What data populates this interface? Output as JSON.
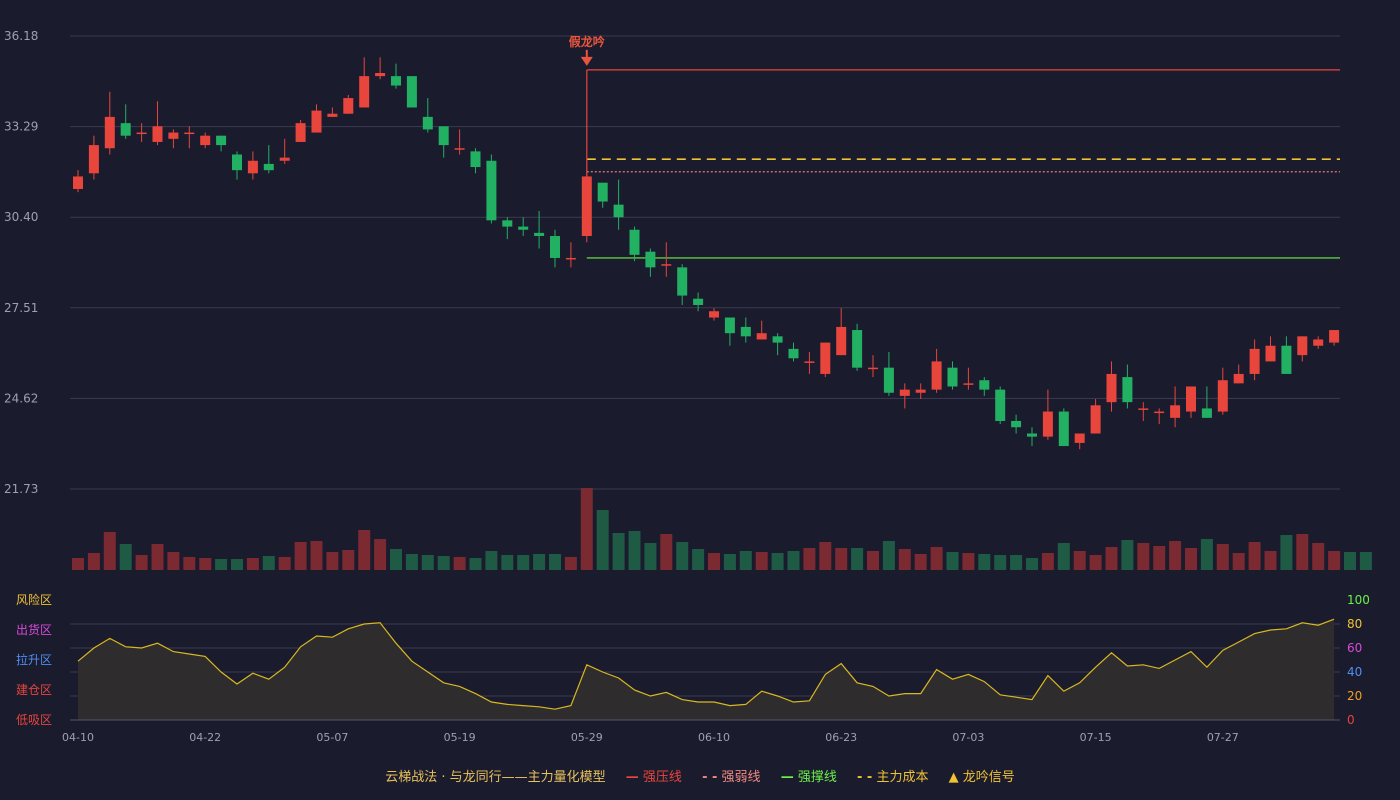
{
  "chart_data": {
    "type": "candlestick",
    "price_axis": {
      "ticks": [
        "36.18",
        "33.29",
        "30.40",
        "27.51",
        "24.62",
        "21.73"
      ],
      "ylim": [
        21.73,
        36.18
      ]
    },
    "x_tick_labels": [
      {
        "i": 0,
        "label": "04-10"
      },
      {
        "i": 8,
        "label": "04-22"
      },
      {
        "i": 16,
        "label": "05-07"
      },
      {
        "i": 24,
        "label": "05-19"
      },
      {
        "i": 32,
        "label": "05-29"
      },
      {
        "i": 40,
        "label": "06-10"
      },
      {
        "i": 48,
        "label": "06-23"
      },
      {
        "i": 56,
        "label": "07-03"
      },
      {
        "i": 64,
        "label": "07-15"
      },
      {
        "i": 72,
        "label": "07-27"
      }
    ],
    "candles": [
      [
        31.3,
        31.7,
        31.2,
        31.9
      ],
      [
        31.8,
        32.7,
        31.6,
        33.0
      ],
      [
        32.6,
        33.6,
        32.4,
        34.4
      ],
      [
        33.4,
        33.0,
        32.9,
        34.0
      ],
      [
        33.1,
        33.1,
        32.8,
        33.4
      ],
      [
        32.8,
        33.3,
        32.7,
        34.1
      ],
      [
        32.9,
        33.1,
        32.6,
        33.2
      ],
      [
        33.1,
        33.1,
        32.6,
        33.3
      ],
      [
        32.7,
        33.0,
        32.6,
        33.1
      ],
      [
        33.0,
        32.7,
        32.5,
        33.0
      ],
      [
        32.4,
        31.9,
        31.6,
        32.5
      ],
      [
        31.8,
        32.2,
        31.6,
        32.5
      ],
      [
        32.1,
        31.9,
        31.8,
        32.7
      ],
      [
        32.2,
        32.3,
        32.1,
        32.9
      ],
      [
        32.8,
        33.4,
        32.8,
        33.5
      ],
      [
        33.1,
        33.8,
        33.2,
        34.0
      ],
      [
        33.6,
        33.7,
        33.6,
        33.9
      ],
      [
        33.7,
        34.2,
        33.7,
        34.3
      ],
      [
        33.9,
        34.9,
        33.9,
        35.5
      ],
      [
        34.9,
        35.0,
        34.8,
        35.5
      ],
      [
        34.9,
        34.6,
        34.5,
        35.3
      ],
      [
        34.9,
        33.9,
        33.9,
        34.8
      ],
      [
        33.6,
        33.2,
        33.1,
        34.2
      ],
      [
        33.3,
        32.7,
        32.3,
        33.2
      ],
      [
        32.6,
        32.6,
        32.4,
        33.2
      ],
      [
        32.5,
        32.0,
        31.8,
        32.6
      ],
      [
        32.2,
        30.3,
        30.2,
        32.4
      ],
      [
        30.3,
        30.1,
        29.7,
        30.4
      ],
      [
        30.1,
        30.0,
        29.8,
        30.4
      ],
      [
        29.9,
        29.8,
        29.4,
        30.6
      ],
      [
        29.8,
        29.1,
        28.8,
        30.0
      ],
      [
        29.1,
        29.1,
        28.8,
        29.6
      ],
      [
        29.8,
        31.7,
        29.6,
        31.9
      ],
      [
        31.5,
        30.9,
        30.7,
        31.5
      ],
      [
        30.8,
        30.4,
        30.0,
        31.6
      ],
      [
        30.0,
        29.2,
        29.0,
        30.1
      ],
      [
        29.3,
        28.8,
        28.5,
        29.4
      ],
      [
        28.9,
        28.9,
        28.5,
        29.6
      ],
      [
        28.8,
        27.9,
        27.6,
        28.9
      ],
      [
        27.8,
        27.6,
        27.4,
        28.0
      ],
      [
        27.2,
        27.4,
        27.1,
        27.5
      ],
      [
        27.2,
        26.7,
        26.3,
        27.1
      ],
      [
        26.9,
        26.6,
        26.4,
        27.2
      ],
      [
        26.5,
        26.7,
        26.5,
        27.1
      ],
      [
        26.6,
        26.4,
        26.0,
        26.7
      ],
      [
        26.2,
        25.9,
        25.8,
        26.4
      ],
      [
        25.8,
        25.8,
        25.4,
        26.1
      ],
      [
        25.4,
        26.4,
        25.3,
        26.4
      ],
      [
        26.0,
        26.9,
        26.0,
        27.5
      ],
      [
        26.8,
        25.6,
        25.5,
        27.0
      ],
      [
        25.6,
        25.6,
        25.3,
        26.0
      ],
      [
        25.6,
        24.8,
        24.7,
        26.1
      ],
      [
        24.7,
        24.9,
        24.3,
        25.1
      ],
      [
        24.8,
        24.9,
        24.6,
        25.1
      ],
      [
        24.9,
        25.8,
        24.8,
        26.2
      ],
      [
        25.6,
        25.0,
        24.9,
        25.8
      ],
      [
        25.1,
        25.1,
        24.9,
        25.6
      ],
      [
        25.2,
        24.9,
        24.7,
        25.3
      ],
      [
        24.9,
        23.9,
        23.8,
        25.0
      ],
      [
        23.9,
        23.7,
        23.5,
        24.1
      ],
      [
        23.5,
        23.4,
        23.1,
        23.7
      ],
      [
        23.4,
        24.2,
        23.3,
        24.9
      ],
      [
        24.2,
        23.1,
        23.1,
        24.3
      ],
      [
        23.2,
        23.5,
        23.0,
        23.5
      ],
      [
        23.5,
        24.4,
        23.5,
        24.6
      ],
      [
        24.5,
        25.4,
        24.2,
        25.8
      ],
      [
        25.3,
        24.5,
        24.3,
        25.7
      ],
      [
        24.3,
        24.3,
        23.9,
        24.5
      ],
      [
        24.2,
        24.2,
        23.8,
        24.3
      ],
      [
        24.0,
        24.4,
        23.7,
        25.0
      ],
      [
        24.2,
        25.0,
        24.0,
        25.0
      ],
      [
        24.3,
        24.0,
        24.0,
        25.0
      ],
      [
        24.2,
        25.2,
        24.1,
        25.6
      ],
      [
        25.1,
        25.4,
        25.1,
        25.7
      ],
      [
        25.4,
        26.2,
        25.2,
        26.5
      ],
      [
        25.8,
        26.3,
        25.8,
        26.6
      ],
      [
        26.3,
        25.4,
        25.4,
        26.6
      ],
      [
        26.0,
        26.6,
        25.8,
        26.6
      ],
      [
        26.3,
        26.5,
        26.2,
        26.6
      ],
      [
        26.4,
        26.8,
        26.3,
        26.8
      ]
    ],
    "volume": [
      12,
      17,
      38,
      26,
      15,
      26,
      18,
      13,
      12,
      11,
      11,
      12,
      14,
      13,
      28,
      29,
      18,
      20,
      40,
      31,
      21,
      16,
      15,
      14,
      13,
      12,
      19,
      15,
      15,
      16,
      16,
      13,
      82,
      60,
      37,
      39,
      27,
      36,
      28,
      21,
      17,
      16,
      19,
      18,
      17,
      19,
      22,
      28,
      22,
      22,
      19,
      29,
      21,
      16,
      23,
      18,
      17,
      16,
      15,
      15,
      12,
      17,
      27,
      19,
      15,
      23,
      30,
      27,
      24,
      29,
      22,
      31,
      26,
      17,
      28,
      19,
      35,
      36,
      27,
      19,
      18,
      18
    ],
    "signal": {
      "index": 32,
      "label": "假龙吟"
    },
    "levels": [
      {
        "name": "强压线",
        "value": 35.1,
        "color": "#e8453c",
        "style": "solid"
      },
      {
        "name": "主力成本",
        "value": 32.25,
        "color": "#f0c234",
        "style": "dash"
      },
      {
        "name": "强弱线",
        "value": 31.85,
        "color": "#e4786e",
        "style": "dot"
      },
      {
        "name": "强撑线",
        "value": 29.1,
        "color": "#6cf04a",
        "style": "solid"
      }
    ],
    "oscillator": {
      "ylim": [
        0,
        100
      ],
      "ticks": [
        "100",
        "80",
        "60",
        "40",
        "20",
        "0"
      ],
      "tick_colors": [
        "#6cf04a",
        "#f0c234",
        "#d94ad9",
        "#4f8ef0",
        "#f0a020",
        "#e8453c"
      ],
      "zones": [
        {
          "name": "风险区",
          "color": "#f0c234"
        },
        {
          "name": "出货区",
          "color": "#d94ad9"
        },
        {
          "name": "拉升区",
          "color": "#4f8ef0"
        },
        {
          "name": "建仓区",
          "color": "#e8453c"
        },
        {
          "name": "低吸区",
          "color": "#e8453c"
        }
      ],
      "values": [
        49,
        60,
        68,
        61,
        60,
        64,
        57,
        55,
        53,
        40,
        30,
        39,
        34,
        44,
        61,
        70,
        69,
        76,
        80,
        81,
        64,
        49,
        40,
        31,
        28,
        22,
        15,
        13,
        12,
        11,
        9,
        12,
        46,
        40,
        35,
        25,
        20,
        23,
        17,
        15,
        15,
        12,
        13,
        24,
        20,
        15,
        16,
        38,
        47,
        31,
        28,
        20,
        22,
        22,
        42,
        34,
        38,
        32,
        21,
        19,
        17,
        37,
        24,
        31,
        44,
        56,
        45,
        46,
        43,
        50,
        57,
        44,
        58,
        65,
        72,
        75,
        76,
        81,
        79,
        84
      ]
    },
    "colors": {
      "up": "#e8453c",
      "down": "#22b063",
      "up_volume": "#7a2a30",
      "down_volume": "#1e5a44",
      "oscillator_line": "#d8b820",
      "oscillator_fill": "#2f2c2e"
    }
  },
  "legend": {
    "model": "云梯战法 · 与龙同行——主力量化模型",
    "items": [
      {
        "label": "强压线",
        "symbol": "—",
        "color": "#e8453c"
      },
      {
        "label": "强弱线",
        "symbol": "- -",
        "color": "#f08a80"
      },
      {
        "label": "强撑线",
        "symbol": "—",
        "color": "#6cf04a"
      },
      {
        "label": "主力成本",
        "symbol": "- -",
        "color": "#f0c234"
      },
      {
        "label": "龙吟信号",
        "symbol": "▲",
        "color": "#f0c234"
      }
    ]
  }
}
